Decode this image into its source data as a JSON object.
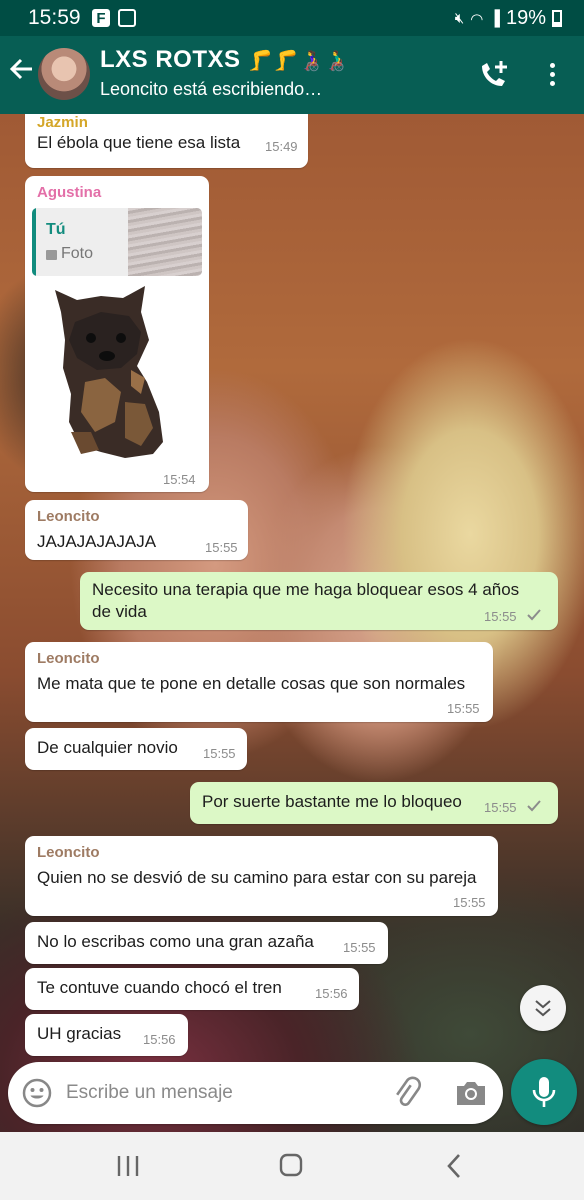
{
  "status_bar": {
    "time": "15:59",
    "battery": "19%",
    "facebook_icon": "F"
  },
  "header": {
    "title": "LXS ROTXS",
    "title_emojis": "🦵🦵👩‍🦽👨‍🦽",
    "subtitle": "Leoncito está escribiendo…"
  },
  "messages": [
    {
      "sender": "Jazmin",
      "sender_color": "#d4a628",
      "text": "El ébola que tiene esa lista",
      "time": "15:49",
      "direction": "in"
    },
    {
      "sender": "Agustina",
      "sender_color": "#e36fa8",
      "quote_author": "Tú",
      "quote_label": "Foto",
      "time": "15:54",
      "direction": "in",
      "type": "sticker"
    },
    {
      "sender": "Leoncito",
      "sender_color": "#9e7b63",
      "text": "JAJAJAJAJAJA",
      "time": "15:55",
      "direction": "in"
    },
    {
      "line1": "Necesito una terapia que me haga bloquear esos 4 años",
      "line2": "de vida",
      "time": "15:55",
      "direction": "out",
      "status": "sent"
    },
    {
      "sender": "Leoncito",
      "sender_color": "#9e7b63",
      "text": "Me mata que te pone en detalle cosas que son normales",
      "time": "15:55",
      "direction": "in"
    },
    {
      "text": "De cualquier novio",
      "time": "15:55",
      "direction": "in"
    },
    {
      "text": "Por suerte bastante me lo bloqueo",
      "time": "15:55",
      "direction": "out",
      "status": "sent"
    },
    {
      "sender": "Leoncito",
      "sender_color": "#9e7b63",
      "text": "Quien no se desvió de su camino para estar con su pareja",
      "time": "15:55",
      "direction": "in"
    },
    {
      "text": "No lo escribas como una gran azaña",
      "time": "15:55",
      "direction": "in"
    },
    {
      "text": "Te contuve cuando chocó el tren",
      "time": "15:56",
      "direction": "in"
    },
    {
      "text": "UH gracias",
      "time": "15:56",
      "direction": "in"
    }
  ],
  "composer": {
    "placeholder": "Escribe un mensaje"
  },
  "colors": {
    "header": "#075e54",
    "status_bar": "#004d44",
    "accent": "#128c7e",
    "outgoing_bubble": "#dcf8c6",
    "incoming_bubble": "#ffffff"
  },
  "icons": [
    "back-arrow-icon",
    "add-call-icon",
    "more-vert-icon",
    "emoji-icon",
    "attach-icon",
    "camera-icon",
    "mic-icon",
    "chevron-down-icon",
    "recents-icon",
    "home-icon",
    "nav-back-icon",
    "check-icon",
    "photo-icon"
  ]
}
